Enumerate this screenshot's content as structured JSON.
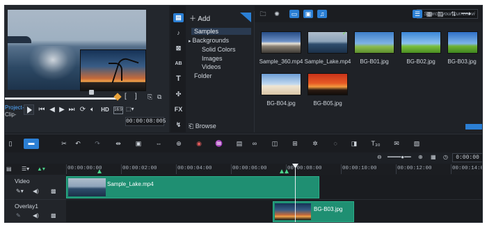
{
  "preview": {
    "project_label": "Project-",
    "clip_label": "Clip-",
    "hd_label": "HD",
    "ratio_label": "16:9",
    "timecode": "00:00:08:005",
    "bracket_in": "[",
    "bracket_out": "]"
  },
  "library": {
    "add_label": "Add",
    "tree": {
      "samples": "Samples",
      "backgrounds": "Backgrounds",
      "solid_colors": "Solid Colors",
      "images": "Images",
      "videos": "Videos",
      "folder": "Folder"
    },
    "browse_label": "Browse",
    "search_placeholder": "Search your current vi",
    "side_icons": [
      "media-icon",
      "instant-project-icon",
      "transition-icon",
      "title-icon",
      "graphics-icon",
      "filter-icon",
      "path-icon"
    ],
    "side_texts": {
      "fx": "FX",
      "title": "T",
      "ab": "AB"
    },
    "thumbnails": [
      {
        "label": "Sample_360.mp4"
      },
      {
        "label": "Sample_Lake.mp4"
      },
      {
        "label": "BG-B01.jpg"
      },
      {
        "label": "BG-B02.jpg"
      },
      {
        "label": "BG-B03.jpg"
      },
      {
        "label": "BG-B04.jpg"
      },
      {
        "label": "BG-B05.jpg"
      }
    ]
  },
  "timeline": {
    "zoom_timecode": "0:00:00",
    "ruler": [
      "00:00:00:00",
      "00:00:02:00",
      "00:00:04:00",
      "00:00:06:00",
      "00:00:08:00",
      "00:00:10:00",
      "00:00:12:00",
      "00:00:14:00"
    ],
    "tracks": [
      {
        "name": "Video",
        "clips": [
          {
            "label": "Sample_Lake.mp4"
          }
        ]
      },
      {
        "name": "Overlay1",
        "clips": [
          {
            "label": "BG-B03.jpg"
          }
        ]
      }
    ]
  },
  "colors": {
    "accent": "#2b7fd4",
    "clip": "#1f8f72",
    "background": "#1d2025"
  }
}
